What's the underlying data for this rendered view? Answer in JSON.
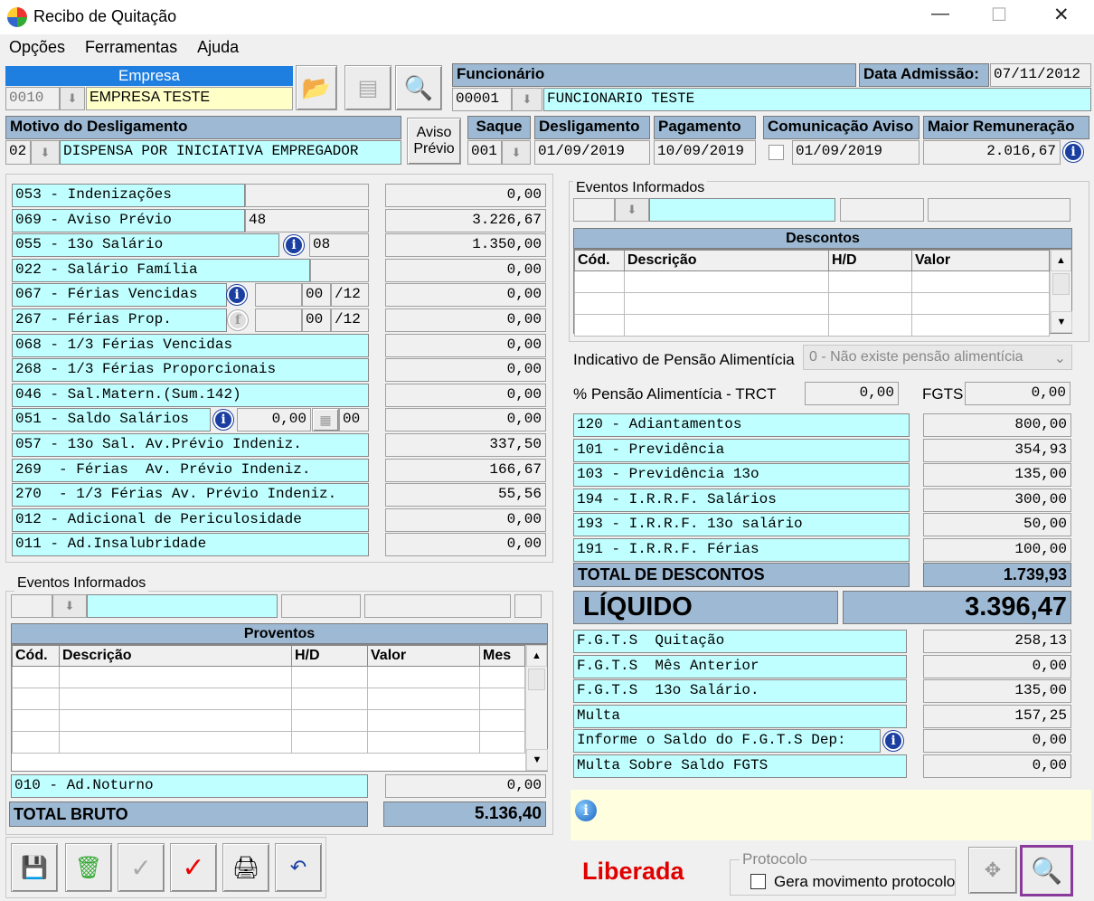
{
  "window": {
    "title": "Recibo de Quitação",
    "min": "—",
    "max": "☐",
    "close": "✕"
  },
  "menu": [
    "Opções",
    "Ferramentas",
    "Ajuda"
  ],
  "empresa": {
    "label": "Empresa",
    "code": "0010",
    "name": "EMPRESA TESTE"
  },
  "funcionario": {
    "label": "Funcionário",
    "code": "00001",
    "name": "FUNCIONARIO TESTE",
    "data_adm_label": "Data Admissão:",
    "data_adm": "07/11/2012"
  },
  "motivo": {
    "label": "Motivo do Desligamento",
    "code": "02",
    "text": "DISPENSA POR INICIATIVA EMPREGADOR"
  },
  "aviso": {
    "l1": "Aviso",
    "l2": "Prévio"
  },
  "saque": {
    "label": "Saque",
    "value": "001"
  },
  "desligamento": {
    "label": "Desligamento",
    "value": "01/09/2019"
  },
  "pagamento": {
    "label": "Pagamento",
    "value": "10/09/2019"
  },
  "comunicacao": {
    "label": "Comunicação Aviso",
    "value": "01/09/2019"
  },
  "maior": {
    "label": "Maior Remuneração",
    "value": "2.016,67"
  },
  "proventos_rows": [
    {
      "label": "053 - Indenizações",
      "value": "0,00",
      "extra": ""
    },
    {
      "label": "069 - Aviso Prévio",
      "value": "3.226,67",
      "extra": "48"
    },
    {
      "label": "055 - 13o Salário",
      "value": "1.350,00",
      "extra": "08"
    },
    {
      "label": "022 - Salário Família",
      "value": "0,00",
      "extra": ""
    },
    {
      "label": "067 - Férias Vencidas",
      "value": "0,00",
      "extra": "00",
      "extra2": "/12"
    },
    {
      "label": "267 - Férias Prop.",
      "value": "0,00",
      "extra": "00",
      "extra2": "/12"
    },
    {
      "label": "068 - 1/3 Férias Vencidas",
      "value": "0,00"
    },
    {
      "label": "268 - 1/3 Férias Proporcionais",
      "value": "0,00"
    },
    {
      "label": "046 - Sal.Matern.(Sum.142)",
      "value": "0,00"
    },
    {
      "label": "051 - Saldo Salários",
      "value": "0,00",
      "extra": "0,00",
      "extra2": "00"
    },
    {
      "label": "057 - 13o Sal. Av.Prévio Indeniz.",
      "value": "337,50"
    },
    {
      "label": "269  - Férias  Av. Prévio Indeniz.",
      "value": "166,67"
    },
    {
      "label": "270  - 1/3 Férias Av. Prévio Indeniz.",
      "value": "55,56"
    },
    {
      "label": "012 - Adicional de Periculosidade",
      "value": "0,00"
    },
    {
      "label": "011 - Ad.Insalubridade",
      "value": "0,00"
    }
  ],
  "eventos_left": {
    "title": "Eventos Informados",
    "grid_title": "Proventos",
    "cols": [
      "Cód.",
      "Descrição",
      "H/D",
      "Valor",
      "Mes"
    ]
  },
  "noturno": {
    "label": "010 - Ad.Noturno",
    "value": "0,00"
  },
  "total_bruto": {
    "label": "TOTAL BRUTO",
    "value": "5.136,40"
  },
  "eventos_right": {
    "title": "Eventos Informados",
    "grid_title": "Descontos",
    "cols": [
      "Cód.",
      "Descrição",
      "H/D",
      "Valor"
    ]
  },
  "pensao": {
    "label": "Indicativo de Pensão Alimentícia",
    "value": "0 - Não existe pensão alimentícia",
    "pct_label": "% Pensão Alimentícia - TRCT",
    "pct_value": "0,00",
    "fgts_label": "FGTS",
    "fgts_value": "0,00"
  },
  "descontos_rows": [
    {
      "label": "120 - Adiantamentos",
      "value": "800,00"
    },
    {
      "label": "101 - Previdência",
      "value": "354,93"
    },
    {
      "label": "103 - Previdência 13o",
      "value": "135,00"
    },
    {
      "label": "194 - I.R.R.F. Salários",
      "value": "300,00"
    },
    {
      "label": "193 - I.R.R.F. 13o salário",
      "value": "50,00"
    },
    {
      "label": "191 - I.R.R.F. Férias",
      "value": "100,00"
    }
  ],
  "total_descontos": {
    "label": "TOTAL DE DESCONTOS",
    "value": "1.739,93"
  },
  "liquido": {
    "label": "LÍQUIDO",
    "value": "3.396,47"
  },
  "fgts_rows": [
    {
      "label": "F.G.T.S  Quitação",
      "value": "258,13"
    },
    {
      "label": "F.G.T.S  Mês Anterior",
      "value": "0,00"
    },
    {
      "label": "F.G.T.S  13o Salário.",
      "value": "135,00"
    },
    {
      "label": "Multa",
      "value": "157,25"
    },
    {
      "label": "Informe o Saldo do F.G.T.S Dep:",
      "value": "0,00"
    },
    {
      "label": "Multa Sobre Saldo FGTS",
      "value": "0,00"
    }
  ],
  "status": {
    "text": "Liberada",
    "color": "#e00000"
  },
  "protocolo": {
    "title": "Protocolo",
    "check_label": "Gera movimento protocolo"
  }
}
